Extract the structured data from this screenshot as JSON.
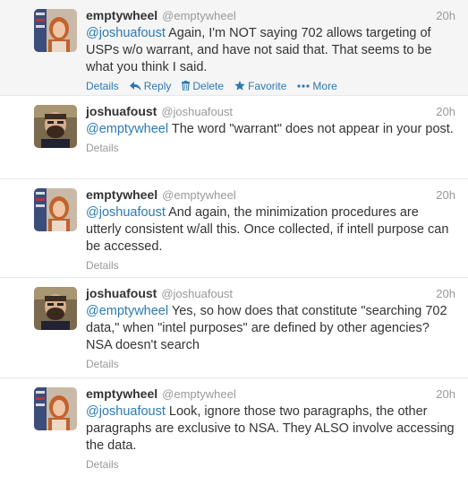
{
  "tweets": [
    {
      "fullname": "emptywheel",
      "username": "@emptywheel",
      "time": "20h",
      "mention": "@joshuafoust",
      "text": " Again, I'm NOT saying 702 allows targeting of USPs w/o warrant, and have not said that. That seems to be what you think I said.",
      "actions": {
        "details": "Details",
        "reply": "Reply",
        "delete": "Delete",
        "favorite": "Favorite",
        "more": "More"
      }
    },
    {
      "fullname": "joshuafoust",
      "username": "@joshuafoust",
      "time": "20h",
      "mention": "@emptywheel",
      "text": " The word \"warrant\" does not appear in your post.",
      "actions": {
        "details": "Details"
      }
    },
    {
      "fullname": "emptywheel",
      "username": "@emptywheel",
      "time": "20h",
      "mention": "@joshuafoust",
      "text": " And again, the minimization procedures are utterly consistent w/all this. Once collected, if intell purpose can be accessed.",
      "actions": {
        "details": "Details"
      }
    },
    {
      "fullname": "joshuafoust",
      "username": "@joshuafoust",
      "time": "20h",
      "mention": "@emptywheel",
      "text": " Yes, so how does that constitute \"searching 702 data,\" when \"intel purposes\" are defined by other agencies? NSA doesn't search",
      "actions": {
        "details": "Details"
      }
    },
    {
      "fullname": "emptywheel",
      "username": "@emptywheel",
      "time": "20h",
      "mention": "@joshuafoust",
      "text": " Look, ignore those two paragraphs, the other paragraphs are exclusive to NSA. They ALSO involve accessing the data.",
      "actions": {
        "details": "Details"
      }
    }
  ]
}
